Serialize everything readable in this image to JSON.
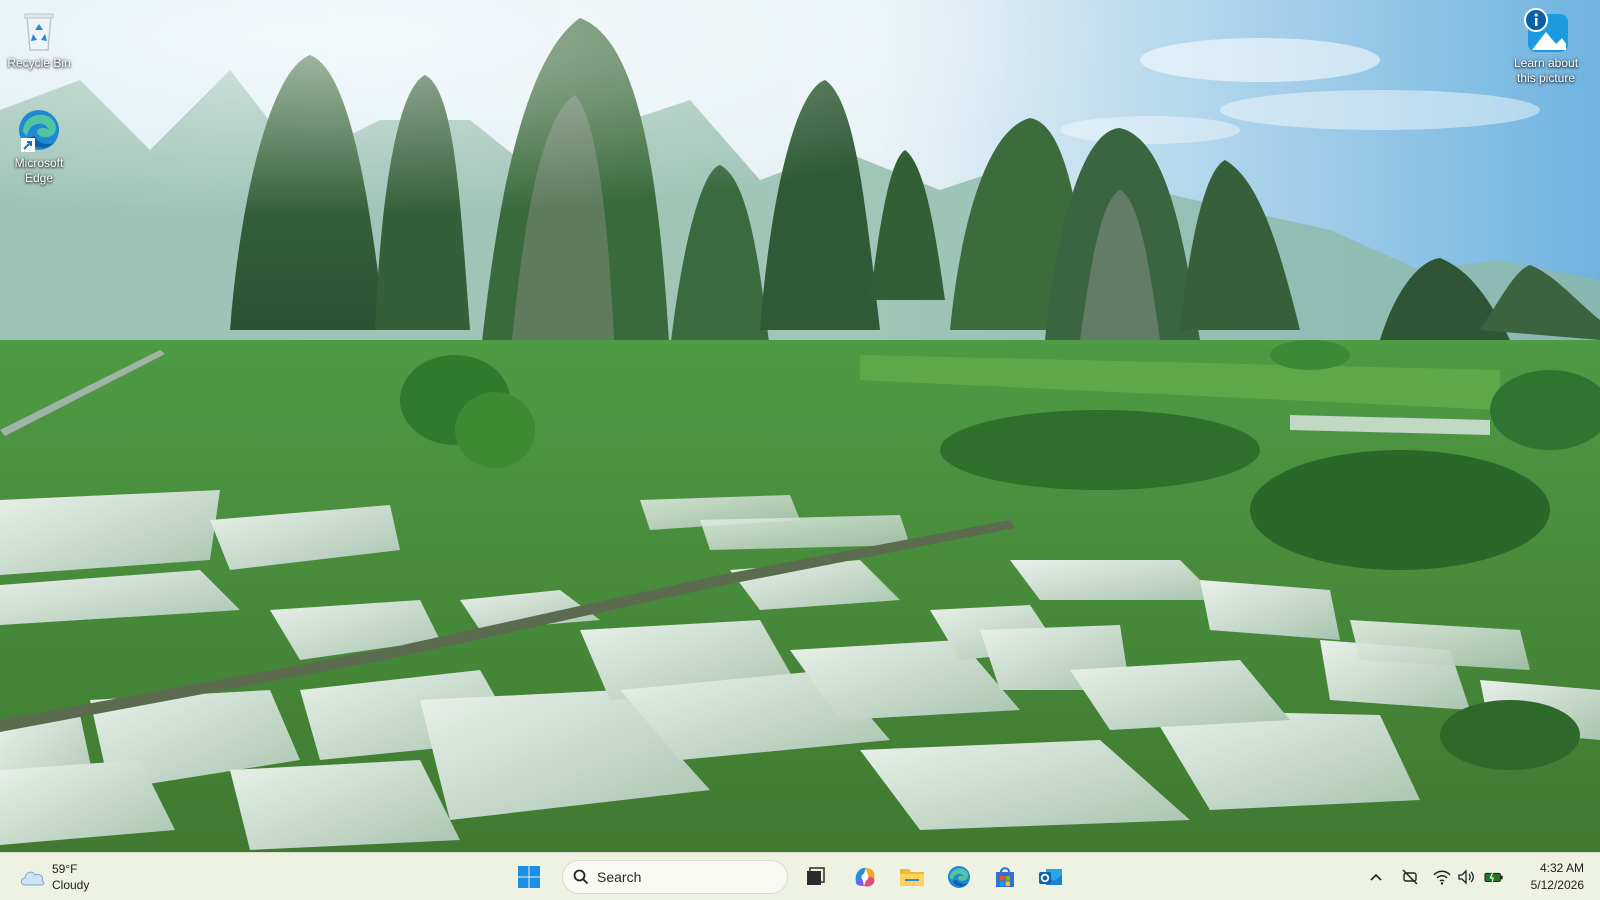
{
  "desktop": {
    "wallpaper": "Karst mountains over flooded rice paddies",
    "icons": [
      {
        "label": "Recycle Bin",
        "icon": "recycle-bin-icon"
      },
      {
        "label": "Microsoft Edge",
        "icon": "edge-icon"
      },
      {
        "label": "Learn about this picture",
        "icon": "info-picture-icon"
      }
    ]
  },
  "taskbar": {
    "weather": {
      "temp": "59°F",
      "condition": "Cloudy",
      "icon": "cloud-icon"
    },
    "start": {
      "icon": "windows-start-icon"
    },
    "search": {
      "label": "Search",
      "icon": "search-icon"
    },
    "apps": [
      {
        "name": "Task View",
        "icon": "task-view-icon"
      },
      {
        "name": "Copilot",
        "icon": "copilot-icon"
      },
      {
        "name": "File Explorer",
        "icon": "folder-icon"
      },
      {
        "name": "Microsoft Edge",
        "icon": "edge-icon"
      },
      {
        "name": "Microsoft Store",
        "icon": "store-icon"
      },
      {
        "name": "Outlook",
        "icon": "outlook-icon"
      }
    ],
    "tray": {
      "chevron": "chevron-up-icon",
      "icons": [
        "no-location-icon",
        "wifi-icon",
        "volume-icon",
        "battery-icon"
      ]
    },
    "clock": {
      "time": "4:32 AM",
      "date": "5/12/2026"
    }
  },
  "colors": {
    "taskbar_bg": "#ECF1E2",
    "accent_blue": "#0078D4"
  }
}
